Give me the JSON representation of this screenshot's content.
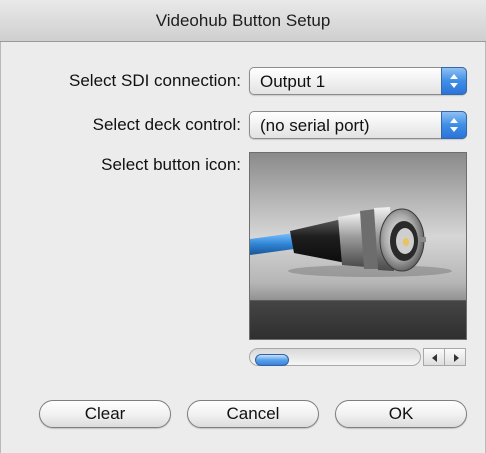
{
  "window": {
    "title": "Videohub Button Setup"
  },
  "form": {
    "sdi_label": "Select SDI connection:",
    "sdi_value": "Output 1",
    "deck_label": "Select deck control:",
    "deck_value": "(no serial port)",
    "icon_label": "Select button icon:"
  },
  "icon_well": {
    "icon": "bnc-connector-icon"
  },
  "scrollbar": {
    "position": 0
  },
  "buttons": {
    "clear": "Clear",
    "cancel": "Cancel",
    "ok": "OK"
  },
  "colors": {
    "accent": "#3e8ee6",
    "cable": "#2f86d6"
  }
}
